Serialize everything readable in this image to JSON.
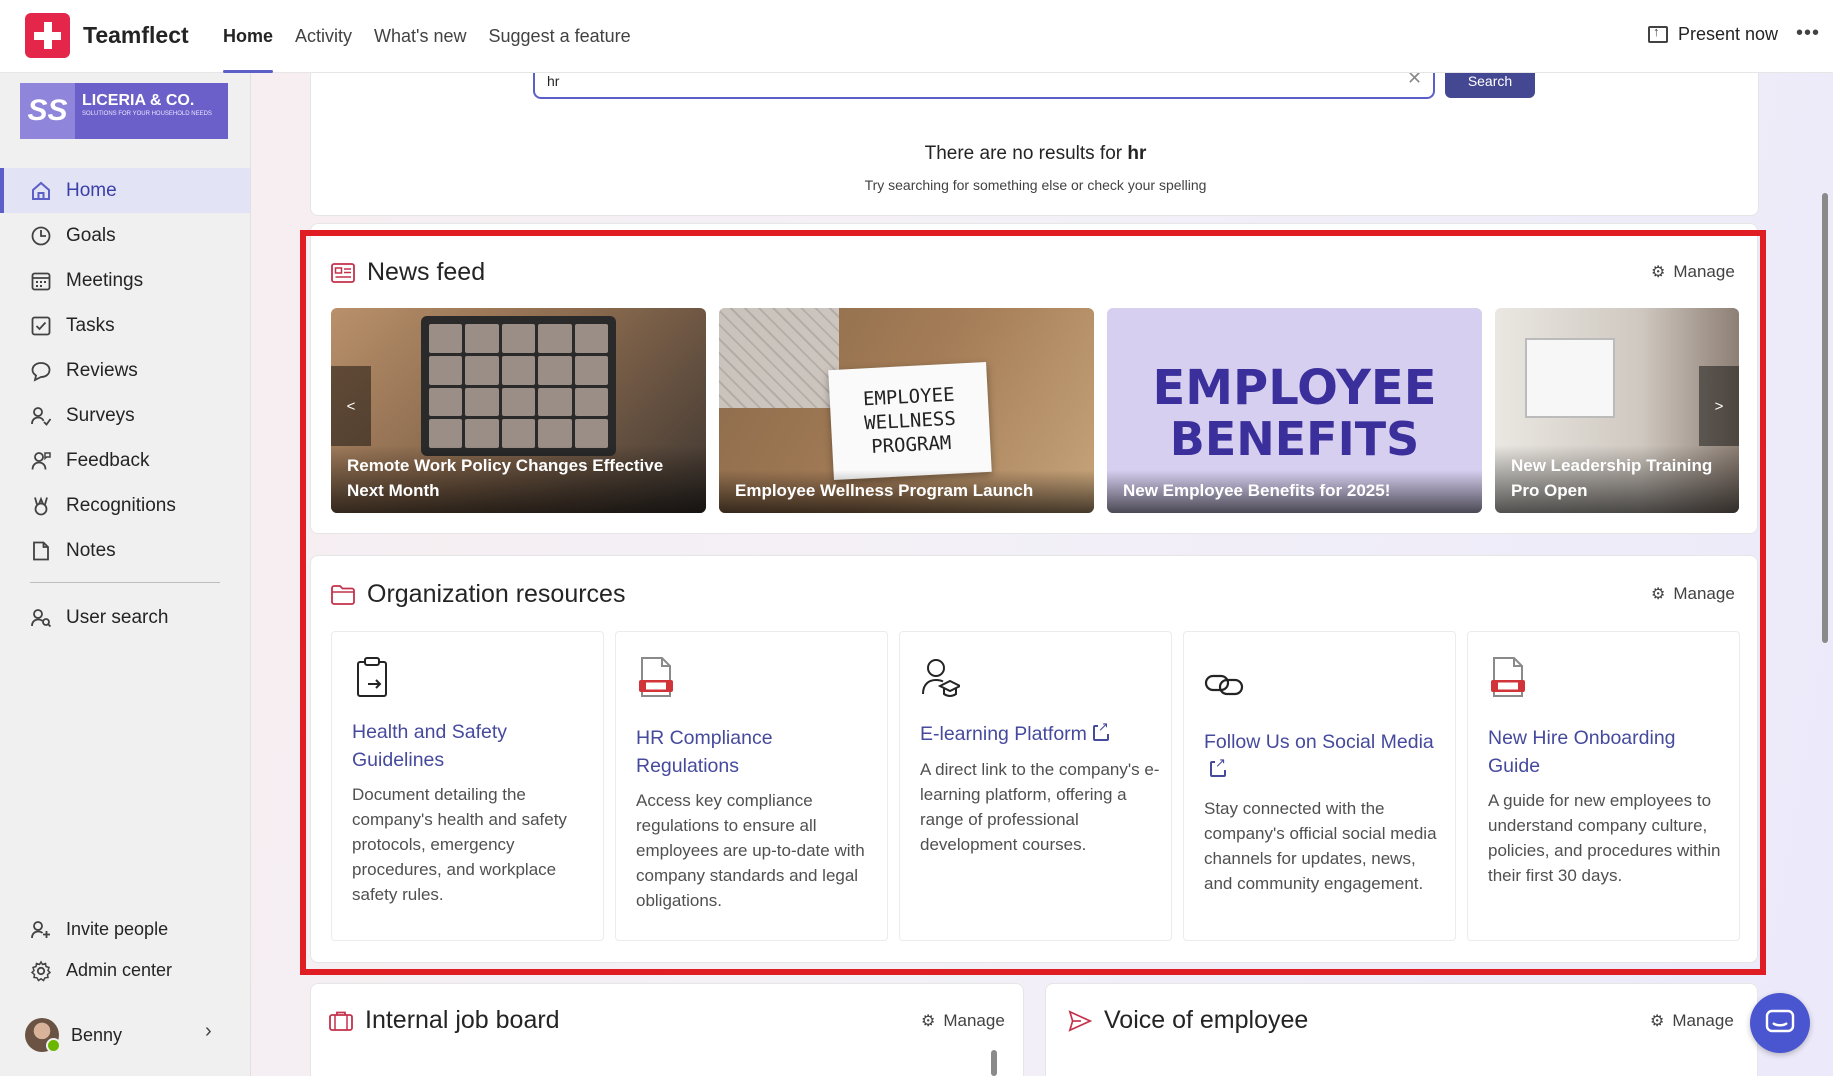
{
  "app": {
    "name": "Teamflect",
    "tabs": [
      {
        "label": "Home",
        "active": true
      },
      {
        "label": "Activity",
        "active": false
      },
      {
        "label": "What's new",
        "active": false
      },
      {
        "label": "Suggest a feature",
        "active": false
      }
    ],
    "present_label": "Present now",
    "accent_color": "#5b5fc7"
  },
  "brand": {
    "monogram": "SS",
    "name": "LICERIA & CO.",
    "tagline": "SOLUTIONS FOR YOUR HOUSEHOLD NEEDS"
  },
  "sidebar": {
    "items": [
      {
        "label": "Home",
        "icon": "home-icon",
        "active": true
      },
      {
        "label": "Goals",
        "icon": "goals-icon"
      },
      {
        "label": "Meetings",
        "icon": "calendar-icon"
      },
      {
        "label": "Tasks",
        "icon": "checkbox-icon"
      },
      {
        "label": "Reviews",
        "icon": "speech-bubble-icon"
      },
      {
        "label": "Surveys",
        "icon": "surveys-icon"
      },
      {
        "label": "Feedback",
        "icon": "person-feedback-icon"
      },
      {
        "label": "Recognitions",
        "icon": "ribbon-icon"
      },
      {
        "label": "Notes",
        "icon": "note-icon"
      }
    ],
    "user_search": "User search",
    "invite": "Invite people",
    "admin": "Admin center",
    "profile_name": "Benny"
  },
  "search": {
    "value": "hr",
    "button": "Search",
    "no_results_prefix": "There are no results for",
    "no_results_term": "hr",
    "hint": "Try searching for something else or check your spelling"
  },
  "news": {
    "title": "News feed",
    "manage": "Manage",
    "items": [
      {
        "caption": "Remote Work Policy Changes Effective Next Month"
      },
      {
        "caption": "Employee Wellness Program Launch",
        "image_text": "EMPLOYEE WELLNESS PROGRAM"
      },
      {
        "caption": "New Employee Benefits for 2025!",
        "image_text_1": "EMPLOYEE",
        "image_text_2": "BENEFITS"
      },
      {
        "caption": "New Leadership Training Pro Open"
      }
    ],
    "prev": "<",
    "next": ">"
  },
  "resources": {
    "title": "Organization resources",
    "manage": "Manage",
    "items": [
      {
        "title": "Health and Safety Guidelines",
        "desc": "Document detailing the company's health and safety protocols, emergency procedures, and workplace safety rules.",
        "icon": "clipboard-icon",
        "external": false
      },
      {
        "title": "HR Compliance Regulations",
        "desc": "Access key compliance regulations to ensure all employees are up-to-date with company standards and legal obligations.",
        "icon": "document-icon",
        "external": false
      },
      {
        "title": "E-learning Platform",
        "desc": "A direct link to the company's e-learning platform, offering a range of professional development courses.",
        "icon": "learner-icon",
        "external": true
      },
      {
        "title": "Follow Us on Social Media",
        "desc": "Stay connected with the company's official social media channels for updates, news, and community engagement.",
        "icon": "link-icon",
        "external": true
      },
      {
        "title": "New Hire Onboarding Guide",
        "desc": "A guide for new employees to understand company culture, policies, and procedures within their first 30 days.",
        "icon": "document-icon",
        "external": false
      }
    ]
  },
  "job_board": {
    "title": "Internal job board",
    "manage": "Manage"
  },
  "voice": {
    "title": "Voice of employee",
    "manage": "Manage"
  }
}
